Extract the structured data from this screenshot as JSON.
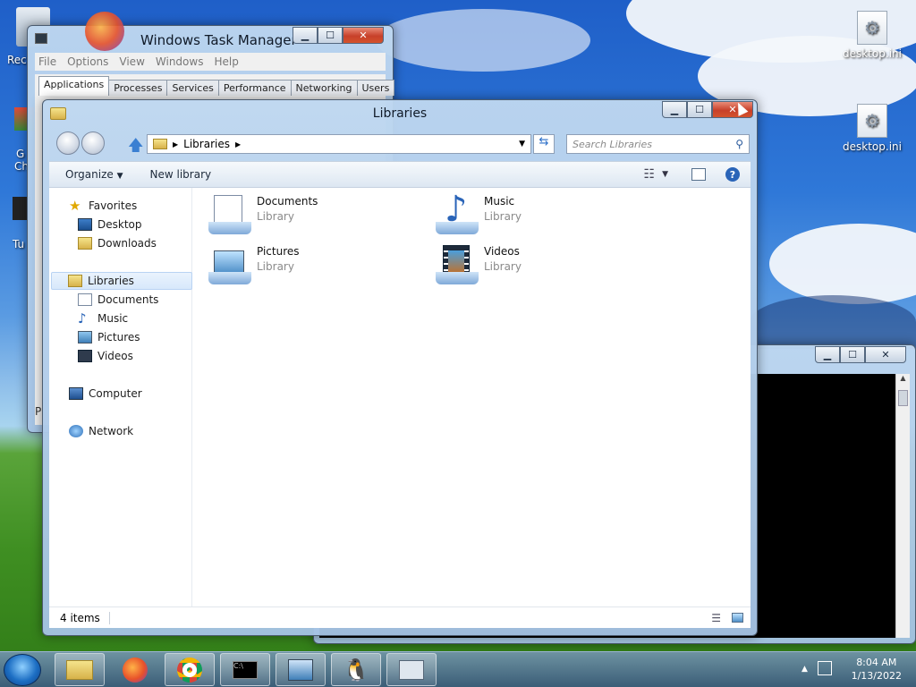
{
  "desktop": {
    "icons": [
      {
        "label": "desktop.ini"
      },
      {
        "label": "desktop.ini"
      }
    ],
    "partial_icons": [
      {
        "label": "Rec"
      },
      {
        "label": "G"
      },
      {
        "label": "Ch"
      },
      {
        "label": "Tu"
      }
    ]
  },
  "task_manager": {
    "title": "Windows Task Manager",
    "menu": [
      "File",
      "Options",
      "View",
      "Windows",
      "Help"
    ],
    "tabs": [
      "Applications",
      "Processes",
      "Services",
      "Performance",
      "Networking",
      "Users"
    ],
    "active_tab": "Applications",
    "footer_text": "P"
  },
  "libraries_window": {
    "title": "Libraries",
    "address_path": "Libraries",
    "search_placeholder": "Search Libraries",
    "toolbar": {
      "organize": "Organize",
      "new_library": "New library"
    },
    "nav": {
      "favorites": {
        "label": "Favorites",
        "items": [
          "Desktop",
          "Downloads"
        ]
      },
      "libraries": {
        "label": "Libraries",
        "items": [
          "Documents",
          "Music",
          "Pictures",
          "Videos"
        ]
      },
      "computer": "Computer",
      "network": "Network"
    },
    "items": [
      {
        "name": "Documents",
        "type": "Library",
        "icon": "documents-library-icon"
      },
      {
        "name": "Music",
        "type": "Library",
        "icon": "music-library-icon"
      },
      {
        "name": "Pictures",
        "type": "Library",
        "icon": "pictures-library-icon"
      },
      {
        "name": "Videos",
        "type": "Library",
        "icon": "videos-library-icon"
      }
    ],
    "status": "4 items"
  },
  "taskbar": {
    "apps": [
      "explorer",
      "firefox",
      "chrome",
      "command-prompt",
      "control-panel",
      "linux-penguin",
      "task-manager"
    ],
    "clock": {
      "time": "8:04 AM",
      "date": "1/13/2022"
    }
  },
  "colors": {
    "close_button": "#c7402a",
    "glass_title": "#a5c3e4",
    "console_bg": "#000000"
  }
}
